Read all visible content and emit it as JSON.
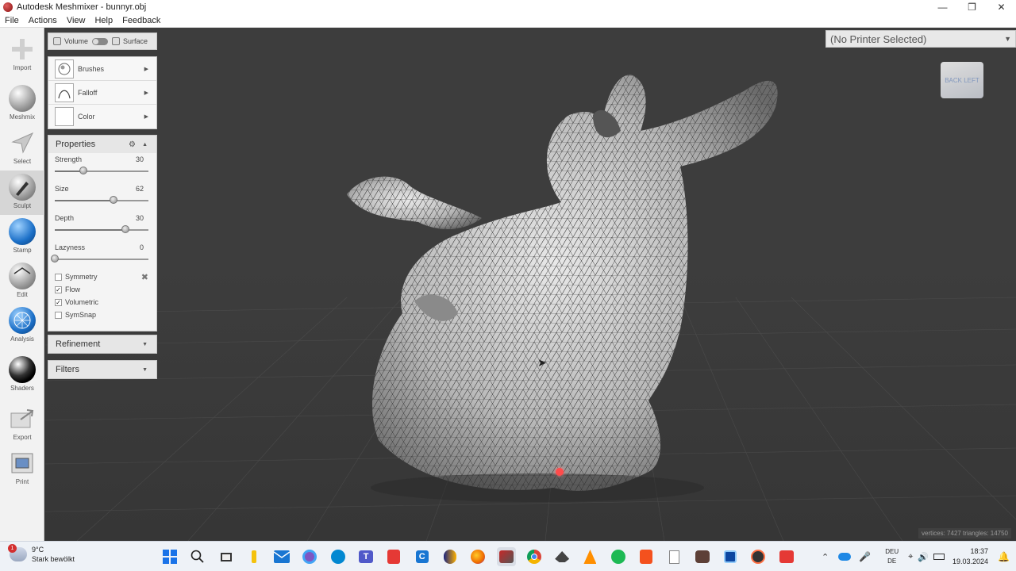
{
  "window": {
    "title": "Autodesk Meshmixer - bunnyr.obj"
  },
  "menu": [
    "File",
    "Actions",
    "View",
    "Help",
    "Feedback"
  ],
  "tools": [
    {
      "label": "Import",
      "icon": "plus-icon"
    },
    {
      "label": "Meshmix",
      "icon": "meshmix-ball-icon"
    },
    {
      "label": "Select",
      "icon": "select-arrow-icon"
    },
    {
      "label": "Sculpt",
      "icon": "sculpt-brush-icon",
      "active": true
    },
    {
      "label": "Stamp",
      "icon": "stamp-icon"
    },
    {
      "label": "Edit",
      "icon": "edit-icon"
    },
    {
      "label": "Analysis",
      "icon": "analysis-icon"
    },
    {
      "label": "Shaders",
      "icon": "shaders-ball-icon"
    },
    {
      "label": "Export",
      "icon": "export-icon"
    },
    {
      "label": "Print",
      "icon": "print-icon"
    }
  ],
  "mode": {
    "volume": "Volume",
    "surface": "Surface"
  },
  "brush_panel": {
    "brushes": "Brushes",
    "falloff": "Falloff",
    "color": "Color"
  },
  "properties": {
    "title": "Properties",
    "sliders": [
      {
        "label": "Strength",
        "value": "30",
        "fraction": 0.3
      },
      {
        "label": "Size",
        "value": "62",
        "fraction": 0.62
      },
      {
        "label": "Depth",
        "value": "30",
        "fraction": 0.74
      },
      {
        "label": "Lazyness",
        "value": "0",
        "fraction": 0.0
      }
    ],
    "checkboxes": [
      {
        "label": "Symmetry",
        "checked": false
      },
      {
        "label": "Flow",
        "checked": true
      },
      {
        "label": "Volumetric",
        "checked": true
      },
      {
        "label": "SymSnap",
        "checked": false
      }
    ]
  },
  "refinement": "Refinement",
  "filters": "Filters",
  "viewport": {
    "printer": "(No Printer Selected)",
    "navcube": "BACK  LEFT",
    "stats": "vertices: 7427 triangles: 14750"
  },
  "taskbar": {
    "temperature": "9°C",
    "weather": "Stark bewölkt",
    "badge": "1",
    "lang1": "DEU",
    "lang2": "DE",
    "time": "18:37",
    "date": "19.03.2024"
  }
}
